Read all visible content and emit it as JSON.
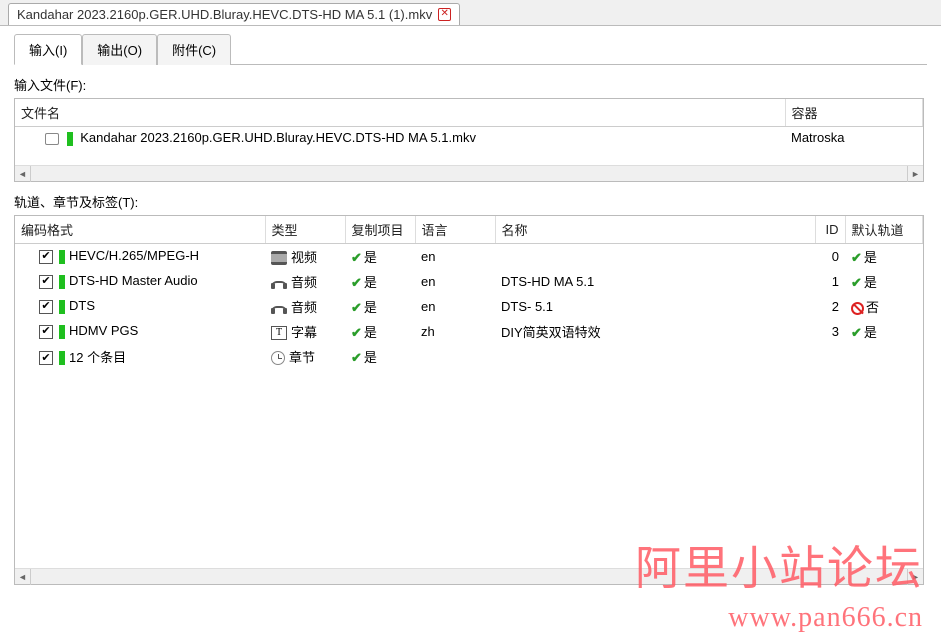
{
  "window_tab": {
    "title": "Kandahar 2023.2160p.GER.UHD.Bluray.HEVC.DTS-HD MA 5.1 (1).mkv"
  },
  "tabs": {
    "input": "输入(I)",
    "output": "输出(O)",
    "attach": "附件(C)"
  },
  "input_section_label": "输入文件(F):",
  "file_table": {
    "cols": {
      "filename": "文件名",
      "container": "容器"
    },
    "rows": [
      {
        "filename": "Kandahar 2023.2160p.GER.UHD.Bluray.HEVC.DTS-HD MA 5.1.mkv",
        "container": "Matroska"
      }
    ]
  },
  "tracks_section_label": "轨道、章节及标签(T):",
  "tracks_table": {
    "cols": {
      "codec": "编码格式",
      "type": "类型",
      "copy": "复制项目",
      "lang": "语言",
      "name": "名称",
      "id": "ID",
      "default": "默认轨道"
    },
    "rows": [
      {
        "checked": true,
        "codec": "HEVC/H.265/MPEG-H",
        "type_icon": "video",
        "type": "视频",
        "copy": "是",
        "lang": "en",
        "name": "",
        "id": "0",
        "default_ok": true,
        "default": "是"
      },
      {
        "checked": true,
        "codec": "DTS-HD Master Audio",
        "type_icon": "audio",
        "type": "音频",
        "copy": "是",
        "lang": "en",
        "name": "DTS-HD MA 5.1",
        "id": "1",
        "default_ok": true,
        "default": "是"
      },
      {
        "checked": true,
        "codec": "DTS",
        "type_icon": "audio",
        "type": "音频",
        "copy": "是",
        "lang": "en",
        "name": "DTS- 5.1",
        "id": "2",
        "default_ok": false,
        "default": "否"
      },
      {
        "checked": true,
        "codec": "HDMV PGS",
        "type_icon": "sub",
        "type": "字幕",
        "copy": "是",
        "lang": "zh",
        "name": "DIY简英双语特效",
        "id": "3",
        "default_ok": true,
        "default": "是"
      },
      {
        "checked": true,
        "codec": "12 个条目",
        "type_icon": "chapter",
        "type": "章节",
        "copy": "是",
        "lang": "",
        "name": "",
        "id": "",
        "default_ok": null,
        "default": ""
      }
    ]
  },
  "watermark": {
    "line1": "阿里小站论坛",
    "line2": "www.pan666.cn"
  }
}
